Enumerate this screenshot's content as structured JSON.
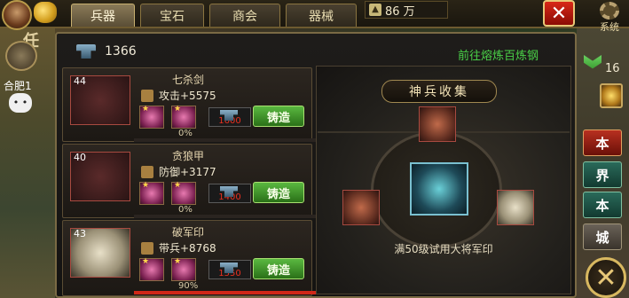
{
  "top_tabs": [
    {
      "label": "兵器",
      "active": true
    },
    {
      "label": "宝石",
      "active": false
    },
    {
      "label": "商会",
      "active": false
    },
    {
      "label": "器械",
      "active": false
    }
  ],
  "currency": {
    "amount": "86 万",
    "icon": "silver-ingot-icon"
  },
  "system_label": "系统",
  "left_hud": {
    "task_label": "任",
    "city_label": "合肥1"
  },
  "right_hud": {
    "rank_number": "16",
    "side_buttons": [
      "本",
      "界",
      "本",
      "城"
    ]
  },
  "panel": {
    "stock_count": "1366",
    "smelt_link": "前往熔炼百炼钢",
    "items": [
      {
        "name": "七杀剑",
        "level": "44",
        "stat": "攻击+5575",
        "stat_icon": "sword-icon",
        "cost": "1600",
        "forge_label": "铸造",
        "progress_text": "0%",
        "progress": 0.0
      },
      {
        "name": "贪狼甲",
        "level": "40",
        "stat": "防御+3177",
        "stat_icon": "shield-icon",
        "cost": "1400",
        "forge_label": "铸造",
        "progress_text": "0%",
        "progress": 0.0
      },
      {
        "name": "破军印",
        "level": "43",
        "stat": "带兵+8768",
        "stat_icon": "soldier-icon",
        "cost": "1550",
        "forge_label": "铸造",
        "progress_text": "90%",
        "progress": 0.9
      }
    ],
    "collection": {
      "title": "神兵收集",
      "caption": "满50级试用大将军印"
    }
  },
  "colors": {
    "forge_green": "#2a7018",
    "cost_red": "#e83020",
    "link_green": "#4ad048",
    "close_red": "#d82818"
  }
}
